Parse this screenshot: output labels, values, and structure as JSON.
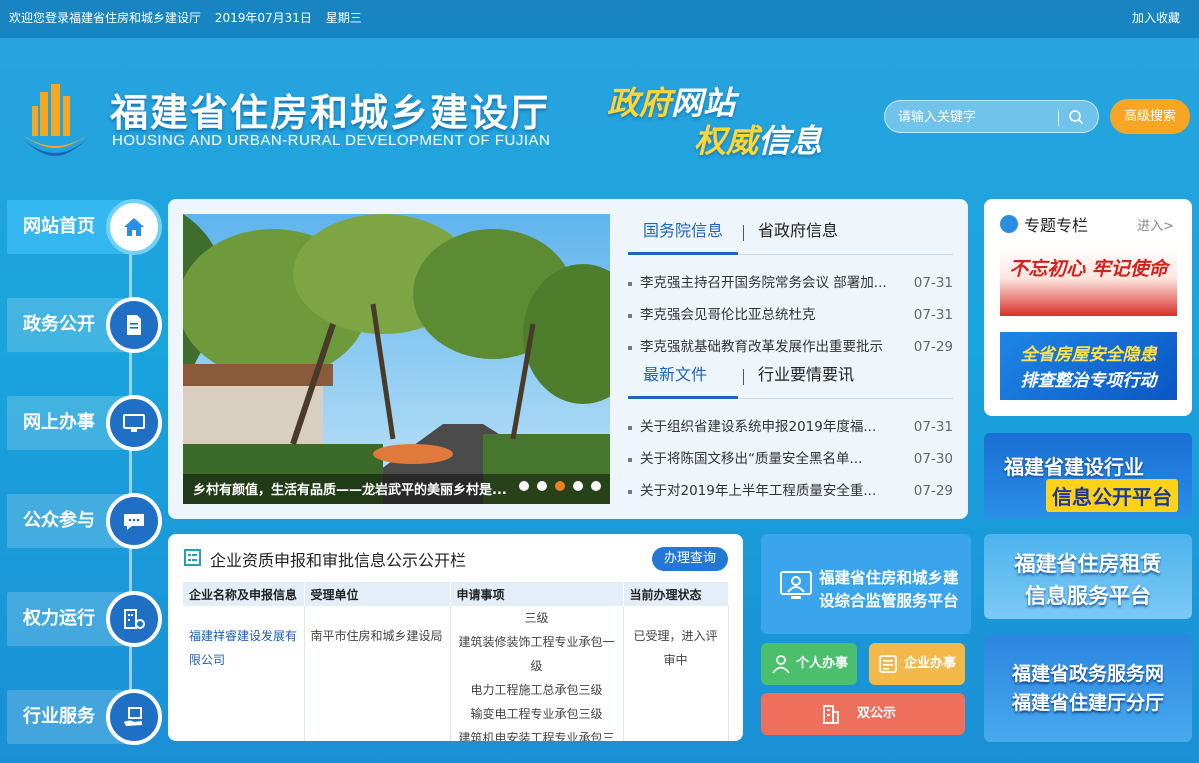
{
  "topbar": {
    "welcome": "欢迎您登录福建省住房和城乡建设厅",
    "date": "2019年07月31日",
    "weekday": "星期三",
    "favorite": "加入收藏"
  },
  "header": {
    "title": "福建省住房和城乡建设厅",
    "subtitle": "HOUSING AND URBAN-RURAL DEVELOPMENT OF FUJIAN",
    "slogan_line1_a": "政府",
    "slogan_line1_b": "网站",
    "slogan_line2_a": "权威",
    "slogan_line2_b": "信息",
    "search_placeholder": "请输入关键字",
    "advanced_search": "高级搜索"
  },
  "nav": {
    "items": [
      {
        "label": "网站首页",
        "icon": "home-icon",
        "active": true
      },
      {
        "label": "政务公开",
        "icon": "document-icon",
        "active": false
      },
      {
        "label": "网上办事",
        "icon": "monitor-icon",
        "active": false
      },
      {
        "label": "公众参与",
        "icon": "chat-icon",
        "active": false
      },
      {
        "label": "权力运行",
        "icon": "building-gear-icon",
        "active": false
      },
      {
        "label": "行业服务",
        "icon": "hand-service-icon",
        "active": false
      }
    ]
  },
  "carousel": {
    "caption": "乡村有颜值，生活有品质——龙岩武平的美丽乡村是...",
    "slides": 5,
    "active_slide": 3
  },
  "news1": {
    "tabs": [
      "国务院信息",
      "省政府信息"
    ],
    "active_tab": 0,
    "items": [
      {
        "title": "李克强主持召开国务院常务会议 部署加...",
        "date": "07-31"
      },
      {
        "title": "李克强会见哥伦比亚总统杜克",
        "date": "07-31"
      },
      {
        "title": "李克强就基础教育改革发展作出重要批示",
        "date": "07-29"
      }
    ]
  },
  "news2": {
    "tabs": [
      "最新文件",
      "行业要情要讯"
    ],
    "active_tab": 0,
    "items": [
      {
        "title": "关于组织省建设系统申报2019年度福...",
        "date": "07-31"
      },
      {
        "title": "关于将陈国文移出“质量安全黑名单...",
        "date": "07-30"
      },
      {
        "title": "关于对2019年上半年工程质量安全重...",
        "date": "07-29"
      }
    ]
  },
  "special": {
    "title": "专题专栏",
    "more": "进入>",
    "banner1": "不忘初心 牢记使命",
    "banner2_line1": "全省房屋安全隐患",
    "banner2_line2": "排查整治专项行动"
  },
  "platforms": {
    "p1_line1": "福建省建设行业",
    "p1_line2": "信息公开平台",
    "p2_line1": "福建省住房租赁",
    "p2_line2": "信息服务平台",
    "p3_line1": "福建省政务服务网",
    "p3_line2": "福建省住建厅分厅"
  },
  "qualifications": {
    "title": "企业资质申报和审批信息公示公开栏",
    "query_button": "办理查询",
    "columns": [
      "企业名称及申报信息",
      "受理单位",
      "申请事项",
      "当前办理状态"
    ],
    "row": {
      "company": "福建祥睿建设发展有限公司",
      "unit": "南平市住房和城乡建设局",
      "items": [
        "三级",
        "建筑装修装饰工程专业承包一级",
        "电力工程施工总承包三级",
        "输变电工程专业承包三级",
        "建筑机电安装工程专业承包三"
      ],
      "status": "已受理，进入评审中"
    }
  },
  "services": {
    "main_line1": "福建省住房和城乡建",
    "main_line2": "设综合监管服务平台",
    "personal": "个人办事",
    "enterprise": "企业办事",
    "dual": "双公示"
  }
}
